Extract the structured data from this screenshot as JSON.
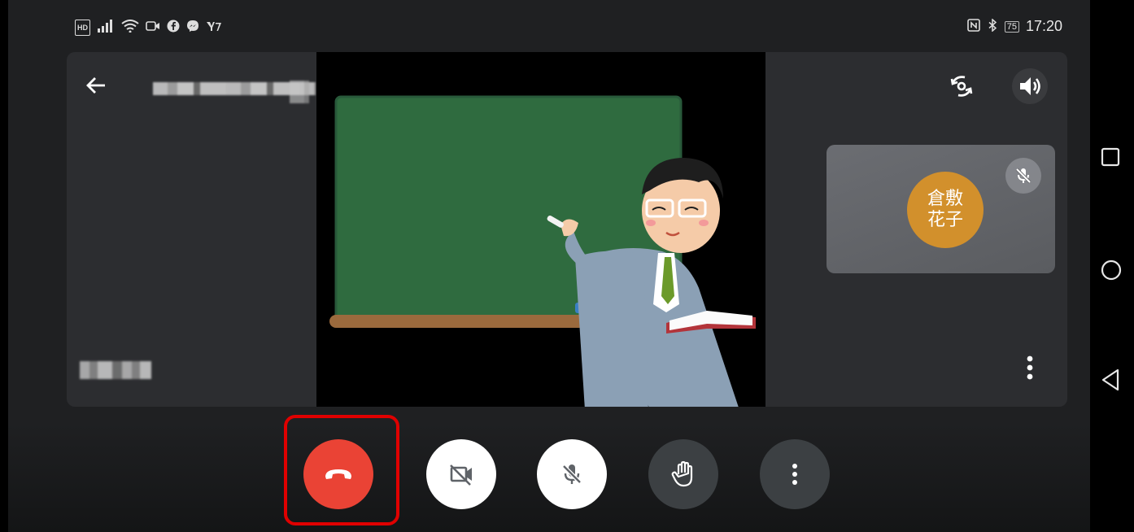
{
  "status_bar": {
    "left_icons": [
      "hd-icon",
      "signal-icon",
      "wifi-icon",
      "video-icon",
      "facebook-icon",
      "messenger-icon",
      "yahoo-icon"
    ],
    "hd_text": "HD",
    "right_icons": [
      "nfc-icon",
      "bluetooth-icon"
    ],
    "battery": "75",
    "time": "17:20"
  },
  "participant": {
    "avatar_text": "倉敷\n花子"
  },
  "icons": {
    "back": "arrow-left-icon",
    "camera_switch": "camera-switch-icon",
    "speaker": "speaker-icon",
    "tile_mic_off": "mic-off-icon",
    "tile_more": "more-vert-icon",
    "hangup": "phone-hangup-icon",
    "camera_off": "videocam-off-icon",
    "mic_off": "mic-off-icon",
    "hand": "raise-hand-icon",
    "more": "more-vert-icon"
  },
  "colors": {
    "hangup": "#ea4335",
    "highlight": "#e00000",
    "avatar": "#d2902c",
    "chalkboard": "#2f6b3f",
    "background": "#1f2022"
  },
  "nav": [
    "recents-icon",
    "home-icon",
    "back-icon"
  ]
}
